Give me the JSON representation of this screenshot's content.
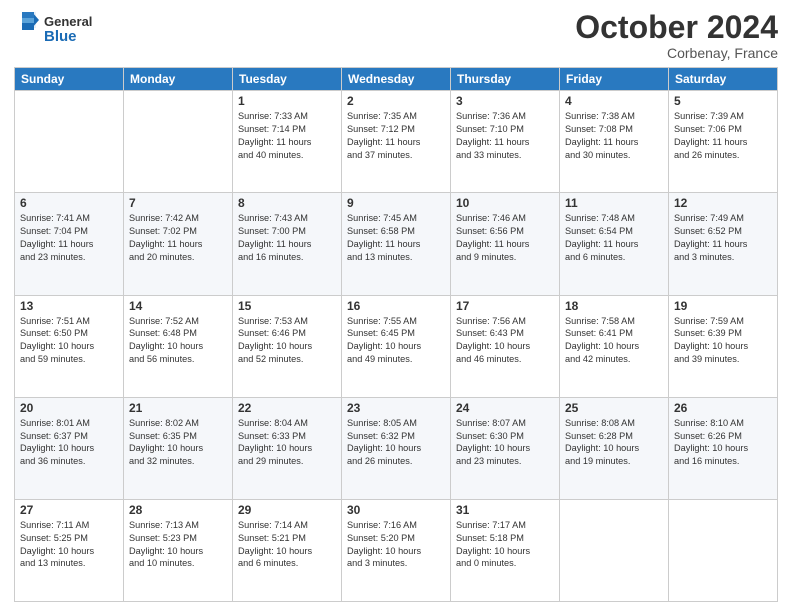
{
  "header": {
    "logo_line1": "General",
    "logo_line2": "Blue",
    "month": "October 2024",
    "location": "Corbenay, France"
  },
  "weekdays": [
    "Sunday",
    "Monday",
    "Tuesday",
    "Wednesday",
    "Thursday",
    "Friday",
    "Saturday"
  ],
  "weeks": [
    [
      {
        "day": "",
        "text": ""
      },
      {
        "day": "",
        "text": ""
      },
      {
        "day": "1",
        "text": "Sunrise: 7:33 AM\nSunset: 7:14 PM\nDaylight: 11 hours\nand 40 minutes."
      },
      {
        "day": "2",
        "text": "Sunrise: 7:35 AM\nSunset: 7:12 PM\nDaylight: 11 hours\nand 37 minutes."
      },
      {
        "day": "3",
        "text": "Sunrise: 7:36 AM\nSunset: 7:10 PM\nDaylight: 11 hours\nand 33 minutes."
      },
      {
        "day": "4",
        "text": "Sunrise: 7:38 AM\nSunset: 7:08 PM\nDaylight: 11 hours\nand 30 minutes."
      },
      {
        "day": "5",
        "text": "Sunrise: 7:39 AM\nSunset: 7:06 PM\nDaylight: 11 hours\nand 26 minutes."
      }
    ],
    [
      {
        "day": "6",
        "text": "Sunrise: 7:41 AM\nSunset: 7:04 PM\nDaylight: 11 hours\nand 23 minutes."
      },
      {
        "day": "7",
        "text": "Sunrise: 7:42 AM\nSunset: 7:02 PM\nDaylight: 11 hours\nand 20 minutes."
      },
      {
        "day": "8",
        "text": "Sunrise: 7:43 AM\nSunset: 7:00 PM\nDaylight: 11 hours\nand 16 minutes."
      },
      {
        "day": "9",
        "text": "Sunrise: 7:45 AM\nSunset: 6:58 PM\nDaylight: 11 hours\nand 13 minutes."
      },
      {
        "day": "10",
        "text": "Sunrise: 7:46 AM\nSunset: 6:56 PM\nDaylight: 11 hours\nand 9 minutes."
      },
      {
        "day": "11",
        "text": "Sunrise: 7:48 AM\nSunset: 6:54 PM\nDaylight: 11 hours\nand 6 minutes."
      },
      {
        "day": "12",
        "text": "Sunrise: 7:49 AM\nSunset: 6:52 PM\nDaylight: 11 hours\nand 3 minutes."
      }
    ],
    [
      {
        "day": "13",
        "text": "Sunrise: 7:51 AM\nSunset: 6:50 PM\nDaylight: 10 hours\nand 59 minutes."
      },
      {
        "day": "14",
        "text": "Sunrise: 7:52 AM\nSunset: 6:48 PM\nDaylight: 10 hours\nand 56 minutes."
      },
      {
        "day": "15",
        "text": "Sunrise: 7:53 AM\nSunset: 6:46 PM\nDaylight: 10 hours\nand 52 minutes."
      },
      {
        "day": "16",
        "text": "Sunrise: 7:55 AM\nSunset: 6:45 PM\nDaylight: 10 hours\nand 49 minutes."
      },
      {
        "day": "17",
        "text": "Sunrise: 7:56 AM\nSunset: 6:43 PM\nDaylight: 10 hours\nand 46 minutes."
      },
      {
        "day": "18",
        "text": "Sunrise: 7:58 AM\nSunset: 6:41 PM\nDaylight: 10 hours\nand 42 minutes."
      },
      {
        "day": "19",
        "text": "Sunrise: 7:59 AM\nSunset: 6:39 PM\nDaylight: 10 hours\nand 39 minutes."
      }
    ],
    [
      {
        "day": "20",
        "text": "Sunrise: 8:01 AM\nSunset: 6:37 PM\nDaylight: 10 hours\nand 36 minutes."
      },
      {
        "day": "21",
        "text": "Sunrise: 8:02 AM\nSunset: 6:35 PM\nDaylight: 10 hours\nand 32 minutes."
      },
      {
        "day": "22",
        "text": "Sunrise: 8:04 AM\nSunset: 6:33 PM\nDaylight: 10 hours\nand 29 minutes."
      },
      {
        "day": "23",
        "text": "Sunrise: 8:05 AM\nSunset: 6:32 PM\nDaylight: 10 hours\nand 26 minutes."
      },
      {
        "day": "24",
        "text": "Sunrise: 8:07 AM\nSunset: 6:30 PM\nDaylight: 10 hours\nand 23 minutes."
      },
      {
        "day": "25",
        "text": "Sunrise: 8:08 AM\nSunset: 6:28 PM\nDaylight: 10 hours\nand 19 minutes."
      },
      {
        "day": "26",
        "text": "Sunrise: 8:10 AM\nSunset: 6:26 PM\nDaylight: 10 hours\nand 16 minutes."
      }
    ],
    [
      {
        "day": "27",
        "text": "Sunrise: 7:11 AM\nSunset: 5:25 PM\nDaylight: 10 hours\nand 13 minutes."
      },
      {
        "day": "28",
        "text": "Sunrise: 7:13 AM\nSunset: 5:23 PM\nDaylight: 10 hours\nand 10 minutes."
      },
      {
        "day": "29",
        "text": "Sunrise: 7:14 AM\nSunset: 5:21 PM\nDaylight: 10 hours\nand 6 minutes."
      },
      {
        "day": "30",
        "text": "Sunrise: 7:16 AM\nSunset: 5:20 PM\nDaylight: 10 hours\nand 3 minutes."
      },
      {
        "day": "31",
        "text": "Sunrise: 7:17 AM\nSunset: 5:18 PM\nDaylight: 10 hours\nand 0 minutes."
      },
      {
        "day": "",
        "text": ""
      },
      {
        "day": "",
        "text": ""
      }
    ]
  ]
}
